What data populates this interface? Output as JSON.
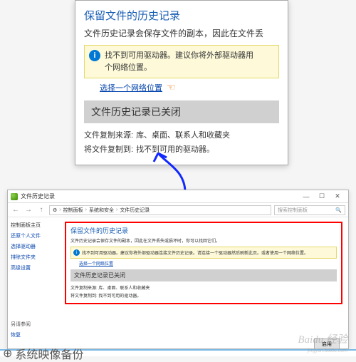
{
  "zoom": {
    "title": "保留文件的历史记录",
    "desc": "文件历史记录会保存文件的副本，因此在文件丢",
    "info": "找不到可用驱动器。建议你将外部驱动器用",
    "info2": "个网络位置。",
    "link": "选择一个网络位置",
    "sub_header": "文件历史记录已关闭",
    "kv1_label": "文件复制来源:",
    "kv1_value": "库、桌面、联系人和收藏夹",
    "kv2_label": "将文件复制到:",
    "kv2_value": "找不到可用的驱动器。"
  },
  "window": {
    "title": "文件历史记录",
    "breadcrumb": [
      "控制面板",
      "系统和安全",
      "文件历史记录"
    ],
    "search_placeholder": "搜索控制面板",
    "sidebar": {
      "hdr": "控制面板主页",
      "items": [
        "还原个人文件",
        "选择驱动器",
        "排除文件夹",
        "高级设置"
      ]
    },
    "main": {
      "title": "保留文件的历史记录",
      "desc": "文件历史记录会保存文件的副本，因此在文件丢失或损坏时，你可以找回它们。",
      "info": "找不到可用驱动器。建议你将外部驱动器连接文件历史记录。请连接一个驱动器然后刷新此页。或者使用一个网络位置。",
      "link": "选择一个网络位置",
      "sub_header": "文件历史记录已关闭",
      "kv1_label": "文件复制来源:",
      "kv1_value": "库、桌面、联系人和收藏夹",
      "kv2_label": "将文件复制到:",
      "kv2_value": "找不到可用的驱动器。",
      "button": "启用"
    },
    "bottom": [
      "另请参阅",
      "恢复",
      "系统映像备份"
    ]
  },
  "watermark": {
    "brand": "Baidu 经验",
    "url": "jingyan.baidu.com"
  }
}
